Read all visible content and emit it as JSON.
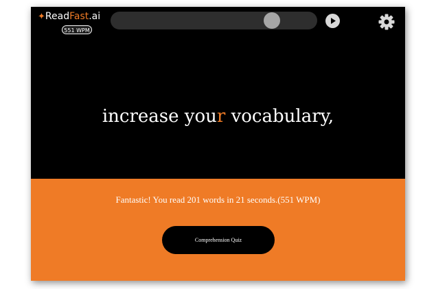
{
  "header": {
    "logo_prefix": "Read",
    "logo_accent": "Fast",
    "logo_suffix": ".ai",
    "wpm_badge": "551 WPM",
    "progress_fraction": 0.78,
    "play_icon": "play-icon",
    "settings_icon": "gear-icon"
  },
  "reader": {
    "before": "increase you",
    "focus_letter": "r",
    "after": " vocabulary,"
  },
  "results": {
    "message": "Fantastic! You read 201 words in 21 seconds.(551 WPM)",
    "quiz_label": "Comprehension Quiz"
  },
  "colors": {
    "accent": "#ef7b26",
    "reader_bg": "#000000",
    "button_bg": "#000000"
  }
}
